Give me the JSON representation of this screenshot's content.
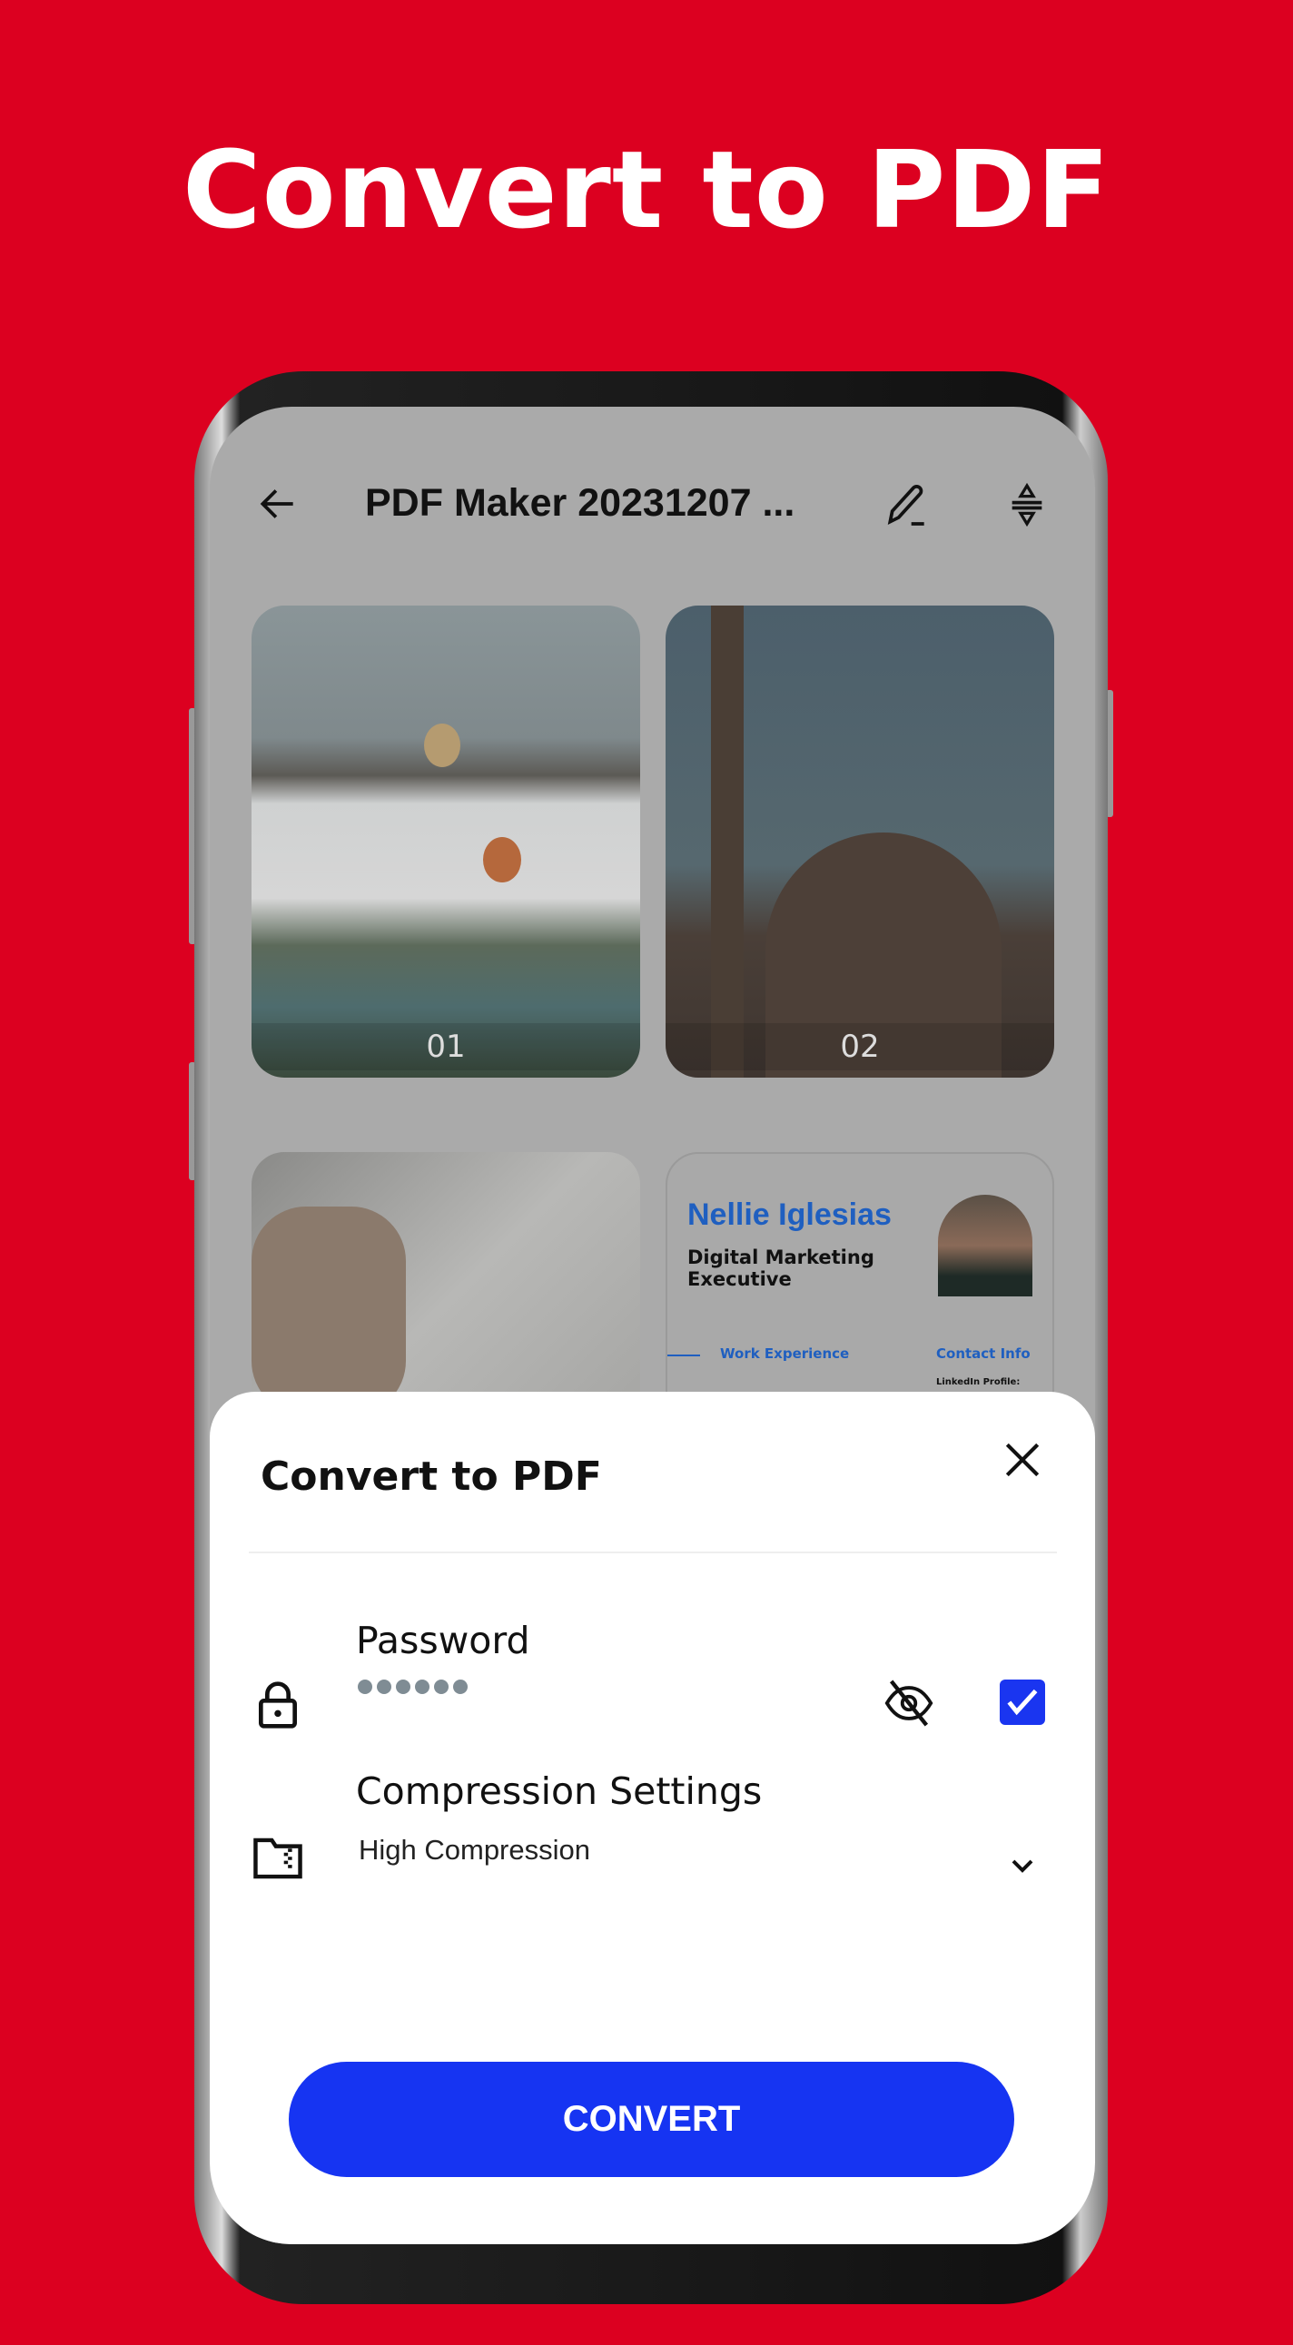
{
  "hero": {
    "title": "Convert to PDF"
  },
  "topbar": {
    "title": "PDF Maker 20231207 ...",
    "back_icon": "arrow-left-icon",
    "edit_icon": "pencil-icon",
    "sort_icon": "sort-icon"
  },
  "pages": [
    {
      "number": "01"
    },
    {
      "number": "02"
    },
    {
      "number": ""
    },
    {
      "number": ""
    }
  ],
  "resume": {
    "name": "Nellie Iglesias",
    "role_line1": "Digital Marketing",
    "role_line2": "Executive",
    "section1": "Work Experience",
    "section2": "Contact Info",
    "contact_label": "LinkedIn Profile:"
  },
  "sheet": {
    "title": "Convert to PDF",
    "password": {
      "label": "Password",
      "dot_count": 6,
      "checked": true
    },
    "compression": {
      "label": "Compression Settings",
      "value": "High Compression"
    },
    "convert_label": "CONVERT"
  },
  "colors": {
    "background": "#dc0020",
    "accent": "#1634f2",
    "resume_blue": "#1f5fc0"
  }
}
